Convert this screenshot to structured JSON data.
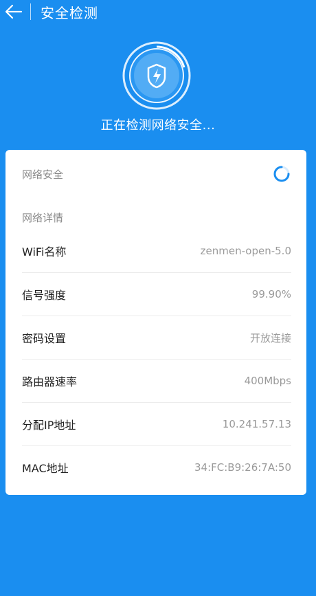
{
  "header": {
    "title": "安全检测"
  },
  "scan": {
    "status": "正在检测网络安全..."
  },
  "card": {
    "security_label": "网络安全",
    "details_label": "网络详情",
    "rows": [
      {
        "key": "WiFi名称",
        "value": "zenmen-open-5.0"
      },
      {
        "key": "信号强度",
        "value": "99.90%"
      },
      {
        "key": "密码设置",
        "value": "开放连接"
      },
      {
        "key": "路由器速率",
        "value": "400Mbps"
      },
      {
        "key": "分配IP地址",
        "value": "10.241.57.13"
      },
      {
        "key": "MAC地址",
        "value": "34:FC:B9:26:7A:50"
      }
    ]
  },
  "colors": {
    "background": "#1a8ef0",
    "ring_light": "#ffffff",
    "shield_inner": "#4aa6f4",
    "spinner": "#1a8ef0"
  },
  "icons": {
    "back": "arrow-left-icon",
    "shield": "shield-lightning-icon",
    "spinner": "loading-spinner-icon"
  }
}
